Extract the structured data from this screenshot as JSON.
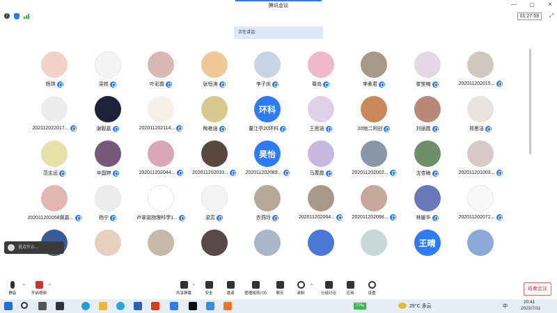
{
  "window": {
    "title": "腾讯会议",
    "minimize": "—",
    "maximize": "▢",
    "close": "✕"
  },
  "infobar": {
    "timer": "01:27:53",
    "expand": "⤢"
  },
  "speaking_label": "正在讲话:",
  "colors": {
    "accent": "#2f7bf5",
    "end_button": "#d33333",
    "battery": "#2fb84a"
  },
  "participants": [
    {
      "name": "杨琪",
      "bg": "#f2d2c8",
      "text": ""
    },
    {
      "name": "梁桂",
      "bg": "#f4f4f4",
      "text": ""
    },
    {
      "name": "叶彩霞",
      "bg": "#d8b8b0",
      "text": ""
    },
    {
      "name": "张恒涛",
      "bg": "#f0c898",
      "text": ""
    },
    {
      "name": "李子庆",
      "bg": "#c8d4e4",
      "text": ""
    },
    {
      "name": "骞岛",
      "bg": "#f0b8c8",
      "text": ""
    },
    {
      "name": "李柔君",
      "bg": "#a89888",
      "text": ""
    },
    {
      "name": "崔笙楠",
      "bg": "#e4d8e4",
      "text": ""
    },
    {
      "name": "202011202015...",
      "bg": "#d0c8c0",
      "text": ""
    },
    {
      "name": "202112022017...",
      "bg": "#ececec",
      "text": ""
    },
    {
      "name": "谢毅嘉",
      "bg": "#1e2238",
      "text": ""
    },
    {
      "name": "202011202114...",
      "bg": "#f4f0e8",
      "text": ""
    },
    {
      "name": "陶艳涵",
      "bg": "#d8c890",
      "text": ""
    },
    {
      "name": "董江亭20环科",
      "bg": "#2f7bf5",
      "text": "环科"
    },
    {
      "name": "王思涵",
      "bg": "#e0d0e8",
      "text": ""
    },
    {
      "name": "20地二阿创",
      "bg": "#c88858",
      "text": ""
    },
    {
      "name": "刘丽霞",
      "bg": "#b88878",
      "text": ""
    },
    {
      "name": "郑思洁",
      "bg": "#e8e4e0",
      "text": ""
    },
    {
      "name": "范志远",
      "bg": "#e8e0a8",
      "text": ""
    },
    {
      "name": "辛国婷",
      "bg": "#785878",
      "text": ""
    },
    {
      "name": "202011202044...",
      "bg": "#d8a8b8",
      "text": ""
    },
    {
      "name": "202011202033...",
      "bg": "#584840",
      "text": ""
    },
    {
      "name": "202011202089...",
      "bg": "#2f7bf5",
      "text": "昊怡"
    },
    {
      "name": "马菁霞",
      "bg": "#c8b8e0",
      "text": ""
    },
    {
      "name": "202011202002...",
      "bg": "#8898a8",
      "text": ""
    },
    {
      "name": "沈杏梅",
      "bg": "#6f8f68",
      "text": ""
    },
    {
      "name": "202011201003...",
      "bg": "#d8c8c8",
      "text": ""
    },
    {
      "name": "202011202058黄嘉...",
      "bg": "#e0b8b0",
      "text": ""
    },
    {
      "name": "杨宁",
      "bg": "#ebebeb",
      "text": ""
    },
    {
      "name": "卢翠滋物理科学1...",
      "bg": "#ffffff",
      "text": ""
    },
    {
      "name": "梁蕊",
      "bg": "#f4f4f4",
      "text": ""
    },
    {
      "name": "农燕玲",
      "bg": "#b8a898",
      "text": ""
    },
    {
      "name": "202011202064...",
      "bg": "#a89888",
      "text": ""
    },
    {
      "name": "202011202098...",
      "bg": "#c8a898",
      "text": ""
    },
    {
      "name": "林媛华",
      "bg": "#6878b8",
      "text": ""
    },
    {
      "name": "202011202072...",
      "bg": "#f8f8f8",
      "text": ""
    },
    {
      "name": "",
      "bg": "#3a5a98",
      "text": ""
    },
    {
      "name": "",
      "bg": "#e8d0c0",
      "text": ""
    },
    {
      "name": "",
      "bg": "#c8b8a8",
      "text": ""
    },
    {
      "name": "",
      "bg": "#584848",
      "text": ""
    },
    {
      "name": "",
      "bg": "#a8b8c8",
      "text": ""
    },
    {
      "name": "",
      "bg": "#4a78d8",
      "text": ""
    },
    {
      "name": "",
      "bg": "#c8d8d8",
      "text": ""
    },
    {
      "name": "",
      "bg": "#2f7bf5",
      "text": "王晴"
    },
    {
      "name": "",
      "bg": "#8aa8d8",
      "text": ""
    }
  ],
  "chat": {
    "placeholder": "说点什么..."
  },
  "toolbar": {
    "mute": "静音",
    "video": "开启视频",
    "share": "共享屏幕",
    "security": "安全",
    "invite": "邀请",
    "manage": "管理成员(73)",
    "chat": "聊天",
    "record": "录制",
    "breakout": "分组讨论",
    "apps": "应用",
    "settings": "设置",
    "end": "结束会议"
  },
  "taskbar": {
    "battery": "77%",
    "weather": "29°C 多云",
    "ime": "中",
    "time": "20:41",
    "date": "2022/7/11"
  }
}
